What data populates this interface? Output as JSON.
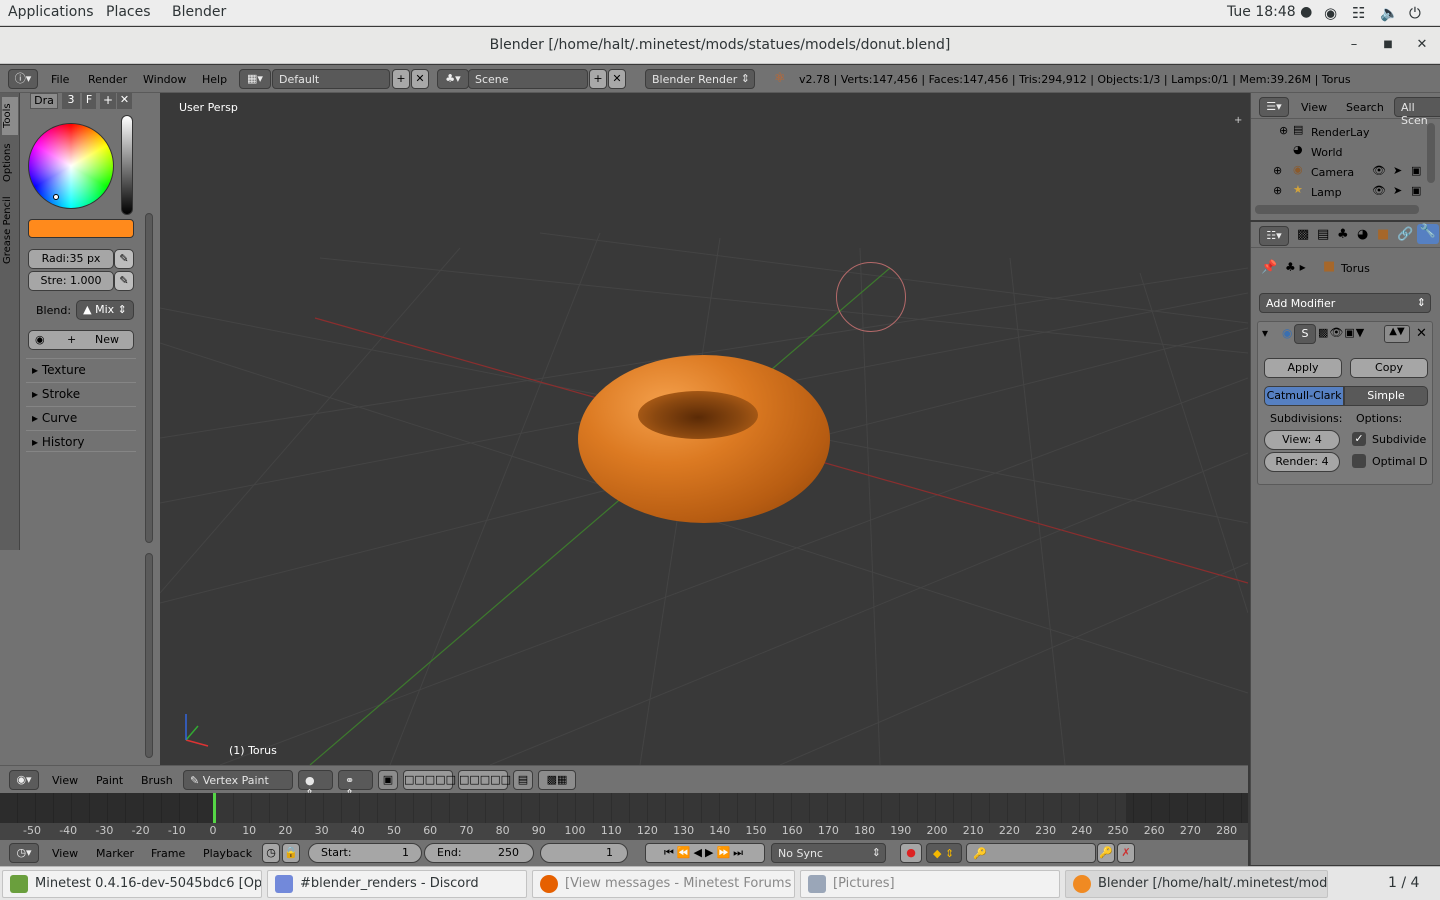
{
  "gnome": {
    "menus": [
      "Applications",
      "Places",
      "Blender"
    ],
    "clock": "Tue 18:48 ●"
  },
  "window": {
    "title": "Blender [/home/halt/.minetest/mods/statues/models/donut.blend]"
  },
  "info_header": {
    "menus": [
      "File",
      "Render",
      "Window",
      "Help"
    ],
    "screen_layout": "Default",
    "scene": "Scene",
    "render_engine": "Blender Render",
    "stats": "v2.78 | Verts:147,456 | Faces:147,456 | Tris:294,912 | Objects:1/3 | Lamps:0/1 | Mem:39.26M | Torus"
  },
  "tool_shelf": {
    "vertical_tabs": [
      "Tools",
      "Options",
      "Grease Pencil"
    ],
    "brush_tabs": [
      "Dra",
      "3",
      "F"
    ],
    "radius": "Radi:35 px",
    "strength": "Stre: 1.000",
    "blend_label": "Blend:",
    "blend_value": "Mix",
    "new_label": "New",
    "panels": [
      "Texture",
      "Stroke",
      "Curve",
      "History"
    ],
    "brush_color": "#ff8a1c"
  },
  "viewport": {
    "view_label": "User Persp",
    "object_label": "(1) Torus"
  },
  "outliner": {
    "menus": [
      "View",
      "Search"
    ],
    "display_mode": "All Scen",
    "items": [
      "RenderLay",
      "World",
      "Camera",
      "Lamp"
    ]
  },
  "properties": {
    "context_object": "Torus",
    "add_modifier": "Add Modifier",
    "modifier_name": "S",
    "apply": "Apply",
    "copy": "Copy",
    "catmull": "Catmull-Clark",
    "simple": "Simple",
    "subdivisions_label": "Subdivisions:",
    "options_label": "Options:",
    "view_levels": "View:",
    "view_levels_value": "4",
    "render_levels": "Render: 4",
    "subdivide_uvs": "Subdivide",
    "optimal_display": "Optimal D"
  },
  "view3d_header": {
    "menus": [
      "View",
      "Paint",
      "Brush"
    ],
    "mode": "Vertex Paint"
  },
  "timeline": {
    "ticks": [
      "-50",
      "-40",
      "-30",
      "-20",
      "-10",
      "0",
      "10",
      "20",
      "30",
      "40",
      "50",
      "60",
      "70",
      "80",
      "90",
      "100",
      "110",
      "120",
      "130",
      "140",
      "150",
      "160",
      "170",
      "180",
      "190",
      "200",
      "210",
      "220",
      "230",
      "240",
      "250",
      "260",
      "270",
      "280"
    ],
    "menus": [
      "View",
      "Marker",
      "Frame",
      "Playback"
    ],
    "start_label": "Start:",
    "start_value": "1",
    "end_label": "End:",
    "end_value": "250",
    "current_frame": "1",
    "sync": "No Sync"
  },
  "taskbar": {
    "tasks": [
      "Minetest 0.4.16-dev-5045bdc6 [Op...",
      "#blender_renders - Discord",
      "[View messages - Minetest Forums ...",
      "[Pictures]",
      "Blender [/home/halt/.minetest/mod..."
    ],
    "workspace": "1 / 4"
  }
}
